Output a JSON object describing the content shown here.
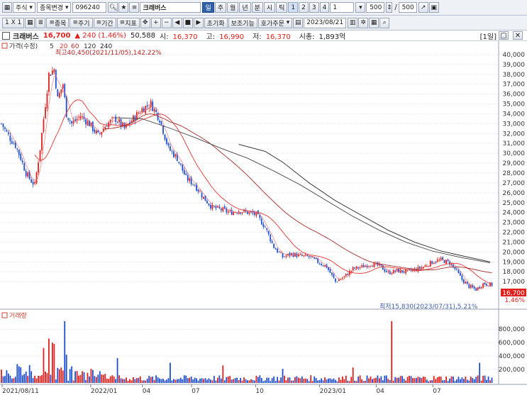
{
  "toolbar1": {
    "market": "주식",
    "stock_change": "종목변경",
    "code": "096240",
    "name": "크래버스",
    "periods": [
      "일",
      "주",
      "월",
      "년",
      "분",
      "시",
      "틱"
    ],
    "active_period": "일",
    "numbers": [
      "1",
      "2",
      "3",
      "4"
    ],
    "interval": "1",
    "count": "500",
    "total": "500"
  },
  "toolbar2": {
    "scale_label": "1 X 1",
    "menu_items": [
      "종목",
      "주기",
      "기간",
      "지표"
    ],
    "reset_label": "초기화",
    "trade_label": "보조기능",
    "order_label": "호가주문",
    "date": "2023/08/21"
  },
  "infobar": {
    "name": "크래버스",
    "price": "16,700",
    "change": "▲ 240",
    "change_pct": "(1.46%)",
    "volume": "50,588",
    "open_label": "시:",
    "open": "16,370",
    "high_label": "고:",
    "high": "16,990",
    "low_label": "저:",
    "low": "16,370",
    "mcap_label": "시총:",
    "mcap": "1,893억",
    "period_tag": "[1일]"
  },
  "price_panel": {
    "legend": "가격(수정)",
    "ma_labels": [
      "5",
      "20",
      "60",
      "120",
      "240"
    ],
    "ma_colors": [
      "#d84a4a",
      "#e3342f",
      "#b23030",
      "#303030",
      "#222222"
    ],
    "high_annotation": "최고40,450(2021/11/05),142.22%",
    "low_annotation": "최저15,830(2023/07/31),5.21%",
    "last_price": "16,700",
    "last_pct": "1.46%"
  },
  "volume_panel": {
    "legend": "거래량"
  },
  "colors": {
    "up": "#e0201c",
    "down": "#1f4fd0",
    "accent": "#2f5fa8"
  },
  "chart_data": {
    "type": "candlestick",
    "title": "",
    "price_axis": [
      40000,
      39000,
      38000,
      37000,
      36000,
      35000,
      34000,
      33000,
      32000,
      31000,
      30000,
      29000,
      28000,
      27000,
      26000,
      25000,
      24000,
      23000,
      22000,
      21000,
      20000,
      19000,
      18000,
      17000
    ],
    "volume_axis": [
      800000,
      600000,
      400000,
      200000
    ],
    "date_ticks": [
      "2021/08/11",
      "2022/01",
      "04",
      "07",
      "10",
      "2023/01",
      "04",
      "07"
    ],
    "price_path": [
      [
        0,
        33000
      ],
      [
        5,
        31500
      ],
      [
        8,
        30800
      ],
      [
        11,
        29500
      ],
      [
        14,
        28000
      ],
      [
        17,
        27200
      ],
      [
        19,
        26800
      ],
      [
        22,
        30500
      ],
      [
        25,
        35000
      ],
      [
        27,
        38000
      ],
      [
        30,
        38500
      ],
      [
        32,
        35500
      ],
      [
        35,
        37000
      ],
      [
        37,
        34000
      ],
      [
        40,
        33000
      ],
      [
        45,
        33800
      ],
      [
        50,
        33000
      ],
      [
        55,
        31800
      ],
      [
        60,
        33000
      ],
      [
        65,
        33500
      ],
      [
        70,
        32500
      ],
      [
        75,
        33500
      ],
      [
        80,
        34500
      ],
      [
        85,
        35000
      ],
      [
        90,
        33500
      ],
      [
        95,
        30500
      ],
      [
        100,
        29500
      ],
      [
        105,
        27500
      ],
      [
        110,
        26800
      ],
      [
        115,
        25500
      ],
      [
        120,
        24500
      ],
      [
        125,
        24300
      ],
      [
        130,
        24000
      ],
      [
        135,
        24200
      ],
      [
        140,
        24000
      ],
      [
        145,
        23800
      ],
      [
        150,
        22500
      ],
      [
        155,
        20500
      ],
      [
        160,
        19500
      ],
      [
        165,
        19800
      ],
      [
        170,
        19600
      ],
      [
        175,
        19500
      ],
      [
        180,
        19000
      ],
      [
        185,
        18500
      ],
      [
        190,
        17000
      ],
      [
        195,
        17500
      ],
      [
        200,
        18300
      ],
      [
        205,
        18500
      ],
      [
        210,
        18800
      ],
      [
        215,
        18600
      ],
      [
        220,
        17900
      ],
      [
        225,
        18100
      ],
      [
        230,
        18000
      ],
      [
        235,
        18200
      ],
      [
        240,
        18500
      ],
      [
        245,
        19000
      ],
      [
        250,
        19200
      ],
      [
        255,
        18900
      ],
      [
        258,
        18300
      ],
      [
        262,
        17200
      ],
      [
        266,
        16500
      ],
      [
        270,
        16200
      ],
      [
        274,
        16800
      ],
      [
        278,
        16700
      ]
    ],
    "ma120_path": [
      [
        65,
        33600
      ],
      [
        80,
        33500
      ],
      [
        95,
        32600
      ],
      [
        110,
        31600
      ],
      [
        125,
        30500
      ],
      [
        140,
        29500
      ],
      [
        155,
        28200
      ],
      [
        170,
        26800
      ],
      [
        185,
        25200
      ],
      [
        200,
        23600
      ],
      [
        215,
        22200
      ],
      [
        230,
        21000
      ],
      [
        245,
        20100
      ],
      [
        260,
        19500
      ],
      [
        278,
        18900
      ]
    ],
    "ma240_path": [
      [
        135,
        30900
      ],
      [
        150,
        30200
      ],
      [
        160,
        29100
      ],
      [
        175,
        27000
      ],
      [
        190,
        25200
      ],
      [
        205,
        23700
      ],
      [
        220,
        22200
      ],
      [
        235,
        21000
      ],
      [
        250,
        20100
      ],
      [
        265,
        19500
      ],
      [
        278,
        19000
      ]
    ],
    "ylim": [
      15500,
      40500
    ]
  }
}
